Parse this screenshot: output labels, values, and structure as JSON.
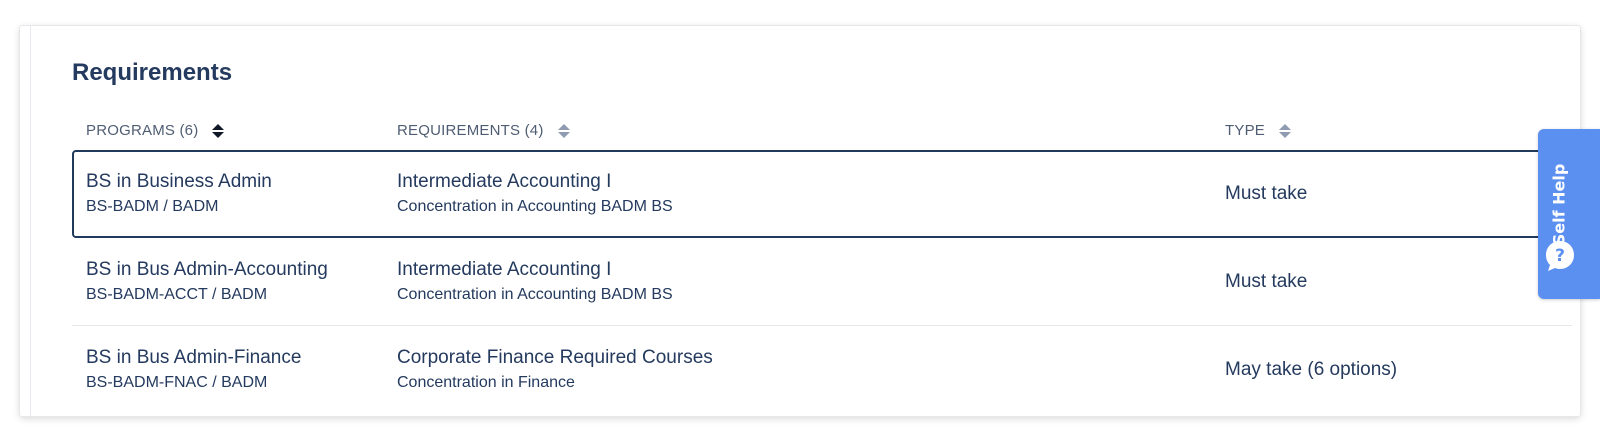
{
  "section": {
    "title": "Requirements"
  },
  "columns": {
    "programs": "PROGRAMS (6)",
    "requirements": "REQUIREMENTS (4)",
    "type": "TYPE"
  },
  "rows": [
    {
      "program": "BS in Business Admin",
      "program_code": "BS-BADM / BADM",
      "requirement": "Intermediate Accounting I",
      "requirement_detail": "Concentration in Accounting BADM BS",
      "type": "Must take",
      "selected": true
    },
    {
      "program": "BS in Bus Admin-Accounting",
      "program_code": "BS-BADM-ACCT / BADM",
      "requirement": "Intermediate Accounting I",
      "requirement_detail": "Concentration in Accounting BADM BS",
      "type": "Must take",
      "selected": false
    },
    {
      "program": "BS in Bus Admin-Finance",
      "program_code": "BS-BADM-FNAC / BADM",
      "requirement": "Corporate Finance Required Courses",
      "requirement_detail": "Concentration in Finance",
      "type": "May take (6 options)",
      "selected": false
    }
  ],
  "self_help": {
    "label": "Self Help",
    "icon": "question-bubble-icon"
  },
  "colors": {
    "title": "#243a5e",
    "header_text": "#4f5d73",
    "selected_border": "#1f3a5c",
    "self_help_bg": "#5b8ff0"
  }
}
